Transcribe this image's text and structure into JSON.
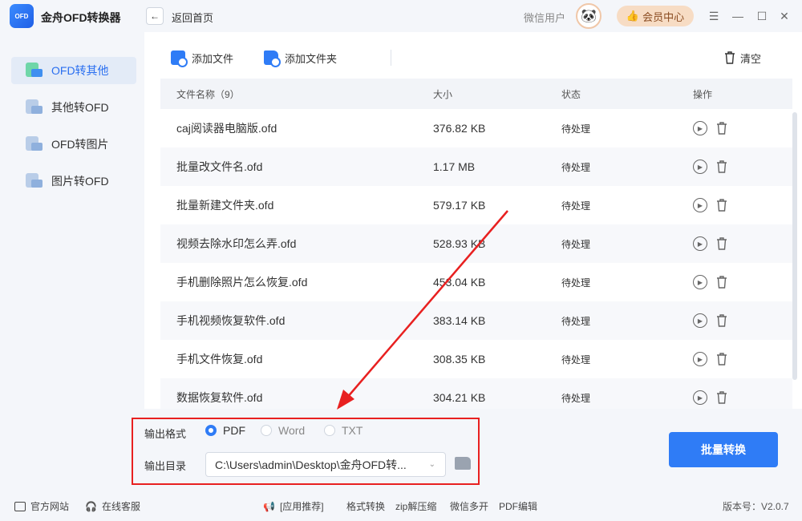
{
  "app": {
    "logo_text": "OFD",
    "title": "金舟OFD转换器"
  },
  "header": {
    "back_label": "返回首页",
    "user_name": "微信用户",
    "vip_label": "会员中心"
  },
  "window_controls": [
    "menu-icon",
    "minimize-icon",
    "maximize-icon",
    "close-icon"
  ],
  "sidebar": {
    "items": [
      {
        "label": "OFD转其他",
        "active": true
      },
      {
        "label": "其他转OFD",
        "active": false
      },
      {
        "label": "OFD转图片",
        "active": false
      },
      {
        "label": "图片转OFD",
        "active": false
      }
    ]
  },
  "toolbar": {
    "add_file": "添加文件",
    "add_folder": "添加文件夹",
    "clear": "清空"
  },
  "table": {
    "headers": {
      "name": "文件名称（9）",
      "size": "大小",
      "status": "状态",
      "op": "操作"
    },
    "rows": [
      {
        "name": "caj阅读器电脑版.ofd",
        "size": "376.82 KB",
        "status": "待处理"
      },
      {
        "name": "批量改文件名.ofd",
        "size": "1.17 MB",
        "status": "待处理"
      },
      {
        "name": "批量新建文件夹.ofd",
        "size": "579.17 KB",
        "status": "待处理"
      },
      {
        "name": "视频去除水印怎么弄.ofd",
        "size": "528.93 KB",
        "status": "待处理"
      },
      {
        "name": "手机删除照片怎么恢复.ofd",
        "size": "453.04 KB",
        "status": "待处理"
      },
      {
        "name": "手机视频恢复软件.ofd",
        "size": "383.14 KB",
        "status": "待处理"
      },
      {
        "name": "手机文件恢复.ofd",
        "size": "308.35 KB",
        "status": "待处理"
      },
      {
        "name": "数据恢复软件.ofd",
        "size": "304.21 KB",
        "status": "待处理"
      }
    ]
  },
  "output": {
    "format_label": "输出格式",
    "formats": [
      {
        "label": "PDF",
        "selected": true
      },
      {
        "label": "Word",
        "selected": false
      },
      {
        "label": "TXT",
        "selected": false
      }
    ],
    "dir_label": "输出目录",
    "dir_value": "C:\\Users\\admin\\Desktop\\金舟OFD转..."
  },
  "convert_button": "批量转换",
  "footer": {
    "official_site": "官方网站",
    "online_service": "在线客服",
    "recommend": "[应用推荐]",
    "links": [
      "格式转换",
      "zip解压缩",
      "微信多开",
      "PDF编辑"
    ],
    "version": "版本号：V2.0.7"
  },
  "colors": {
    "accent": "#2f7cf6",
    "highlight": "#e82020",
    "vip": "#f7dcc4"
  }
}
